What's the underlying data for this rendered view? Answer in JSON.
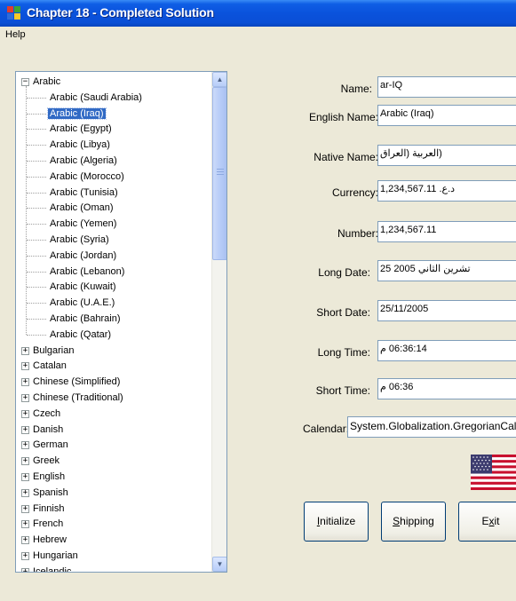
{
  "window": {
    "title": "Chapter 18 - Completed Solution"
  },
  "menu": {
    "items": [
      "Help"
    ]
  },
  "tree": {
    "root": "Arabic",
    "root_expander": "−",
    "children": [
      "Arabic (Saudi Arabia)",
      "Arabic (Iraq)",
      "Arabic (Egypt)",
      "Arabic (Libya)",
      "Arabic (Algeria)",
      "Arabic (Morocco)",
      "Arabic (Tunisia)",
      "Arabic (Oman)",
      "Arabic (Yemen)",
      "Arabic (Syria)",
      "Arabic (Jordan)",
      "Arabic (Lebanon)",
      "Arabic (Kuwait)",
      "Arabic (U.A.E.)",
      "Arabic (Bahrain)",
      "Arabic (Qatar)"
    ],
    "selected": "Arabic (Iraq)",
    "collapsed_expander": "+",
    "collapsed": [
      "Bulgarian",
      "Catalan",
      "Chinese (Simplified)",
      "Chinese (Traditional)",
      "Czech",
      "Danish",
      "German",
      "Greek",
      "English",
      "Spanish",
      "Finnish",
      "French",
      "Hebrew",
      "Hungarian",
      "Icelandic"
    ]
  },
  "scrollbar": {
    "up_arrow": "▲",
    "down_arrow": "▼"
  },
  "details": {
    "name_label": "Name:",
    "name_value": "ar-IQ",
    "english_name_label": "English Name:",
    "english_name_value": "Arabic (Iraq)",
    "native_name_label": "Native Name:",
    "native_name_value": "(العربية (العراق",
    "currency_label": "Currency:",
    "currency_value": "د.ع. 1,234,567.11",
    "number_label": "Number:",
    "number_value": "1,234,567.11",
    "long_date_label": "Long Date:",
    "long_date_value": "تشرين الثاني 2005 25",
    "short_date_label": "Short Date:",
    "short_date_value": "25/11/2005",
    "long_time_label": "Long Time:",
    "long_time_value": "06:36:14 م",
    "short_time_label": "Short Time:",
    "short_time_value": "06:36 م",
    "calendar_label": "Calendar:",
    "calendar_value": "System.Globalization.GregorianCalendar"
  },
  "buttons": {
    "initialize": {
      "mnemonic": "I",
      "rest": "nitialize"
    },
    "shipping": {
      "mnemonic": "S",
      "rest": "hipping"
    },
    "exit": {
      "lead": "E",
      "mnemonic": "x",
      "rest": "it"
    }
  },
  "colors": {
    "title_bar": "#0a52dc",
    "selection": "#316ac5",
    "window_bg": "#ece9d8",
    "field_border": "#7f9db9"
  },
  "icons": {
    "app": "app-icon",
    "flag": "us-flag-icon"
  }
}
